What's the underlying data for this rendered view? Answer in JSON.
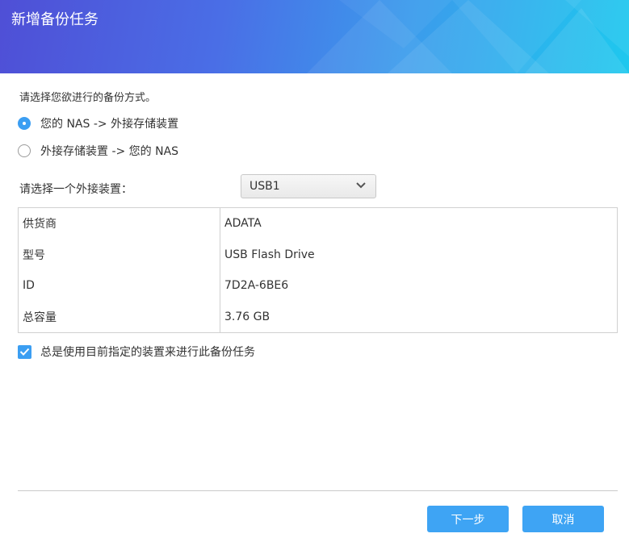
{
  "dialog": {
    "title": "新增备份任务"
  },
  "backup_method": {
    "prompt": "请选择您欲进行的备份方式。",
    "options": [
      {
        "label": "您的 NAS -> 外接存储装置",
        "selected": true
      },
      {
        "label": "外接存储装置 -> 您的 NAS",
        "selected": false
      }
    ]
  },
  "device": {
    "label": "请选择一个外接装置：",
    "selected": "USB1",
    "details": [
      {
        "key": "供货商",
        "value": "ADATA"
      },
      {
        "key": "型号",
        "value": "USB Flash Drive"
      },
      {
        "key": "ID",
        "value": "7D2A-6BE6"
      },
      {
        "key": "总容量",
        "value": "3.76 GB"
      }
    ]
  },
  "always_use_device": {
    "label": "总是使用目前指定的装置来进行此备份任务",
    "checked": true
  },
  "footer": {
    "next_label": "下一步",
    "cancel_label": "取消"
  },
  "colors": {
    "accent": "#3ea4f4",
    "header_start": "#4f4fd6",
    "header_end": "#1ec8ee"
  }
}
